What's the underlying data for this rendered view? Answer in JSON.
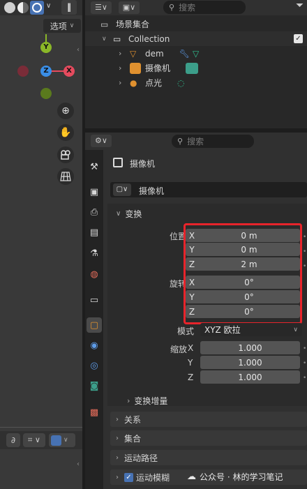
{
  "viewport": {
    "options_label": "选项",
    "gizmo": {
      "y_axis": "Y",
      "z_axis": "Z",
      "x_axis": "X"
    }
  },
  "outliner": {
    "search_placeholder": "搜索",
    "scene_collection": "场景集合",
    "collection": "Collection",
    "items": [
      {
        "name": "dem"
      },
      {
        "name": "摄像机"
      },
      {
        "name": "点光"
      }
    ]
  },
  "properties": {
    "search_placeholder": "搜索",
    "object_name": "摄像机",
    "datablock_name": "摄像机",
    "transform_header": "变换",
    "location_label": "位置",
    "location": [
      {
        "axis": "X",
        "value": "0 m"
      },
      {
        "axis": "Y",
        "value": "0 m"
      },
      {
        "axis": "Z",
        "value": "2 m"
      }
    ],
    "rotation_label": "旋转",
    "rotation": [
      {
        "axis": "X",
        "value": "0°"
      },
      {
        "axis": "Y",
        "value": "0°"
      },
      {
        "axis": "Z",
        "value": "0°"
      }
    ],
    "mode_label": "模式",
    "mode_value": "XYZ 欧拉",
    "scale_label": "缩放",
    "scale": [
      {
        "axis": "X",
        "value": "1.000"
      },
      {
        "axis": "Y",
        "value": "1.000"
      },
      {
        "axis": "Z",
        "value": "1.000"
      }
    ],
    "delta_transform": "变换增量",
    "sections": [
      "关系",
      "集合",
      "运动路径",
      "运动模糊"
    ]
  },
  "watermark": "公众号 · 林的学习笔记",
  "colors": {
    "highlight_border": "#e8242b",
    "axis_x": "#e54b5e",
    "axis_y": "#8ab728",
    "axis_z": "#3a8ee6",
    "accent_blue": "#4772b3",
    "camera_green": "#3c9e8a",
    "mesh_orange": "#e0912f"
  }
}
